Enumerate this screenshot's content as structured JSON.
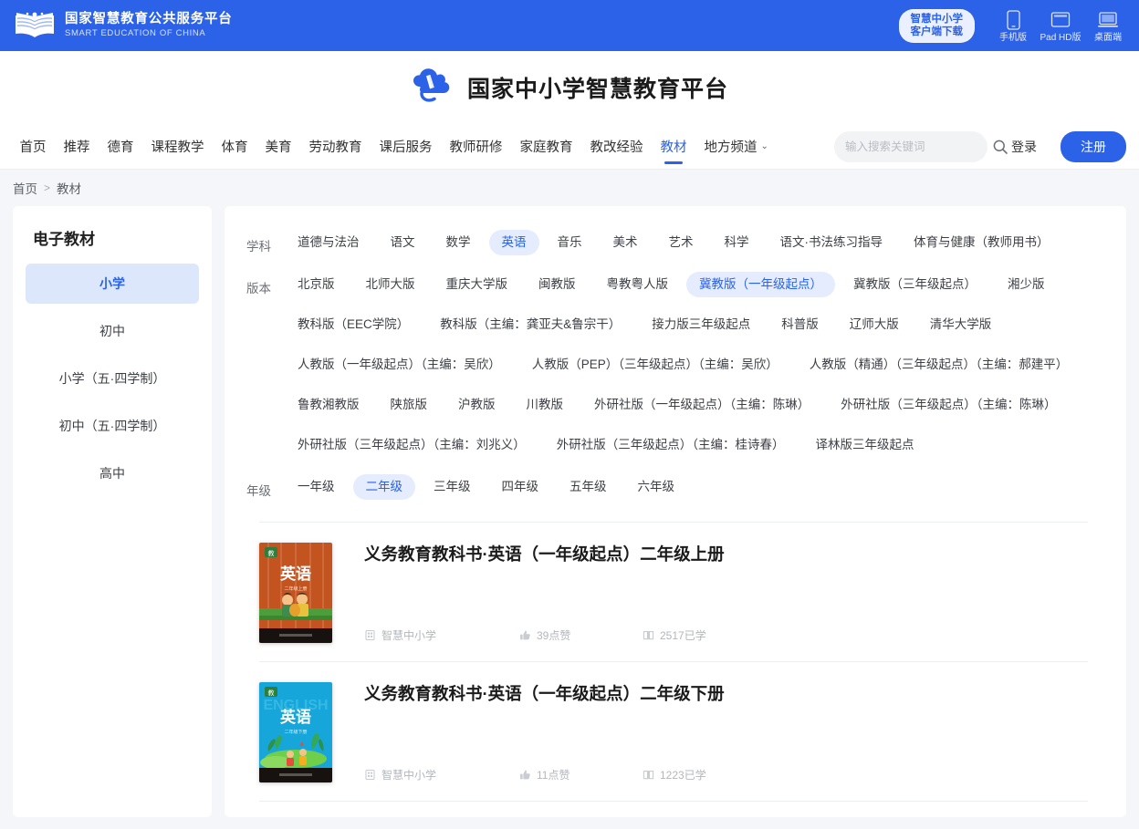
{
  "topbar": {
    "logo_cn": "国家智慧教育公共服务平台",
    "logo_en": "SMART EDUCATION OF CHINA",
    "client_download": {
      "line1": "智慧中小学",
      "line2": "客户端下载"
    },
    "download_items": [
      {
        "icon": "phone-icon",
        "label": "手机版"
      },
      {
        "icon": "tablet-icon",
        "label": "Pad HD版"
      },
      {
        "icon": "desktop-icon",
        "label": "桌面端"
      }
    ],
    "bg_color": "#2B62E8"
  },
  "brand": {
    "title": "国家中小学智慧教育平台",
    "icon": "cloud-pen-logo"
  },
  "nav": {
    "items": [
      {
        "label": "首页",
        "active": false
      },
      {
        "label": "推荐",
        "active": false
      },
      {
        "label": "德育",
        "active": false
      },
      {
        "label": "课程教学",
        "active": false
      },
      {
        "label": "体育",
        "active": false
      },
      {
        "label": "美育",
        "active": false
      },
      {
        "label": "劳动教育",
        "active": false
      },
      {
        "label": "课后服务",
        "active": false
      },
      {
        "label": "教师研修",
        "active": false
      },
      {
        "label": "家庭教育",
        "active": false
      },
      {
        "label": "教改经验",
        "active": false
      },
      {
        "label": "教材",
        "active": true
      },
      {
        "label": "地方频道",
        "active": false,
        "caret": true
      }
    ],
    "search": {
      "placeholder": "输入搜索关键词",
      "value": "",
      "icon": "search-icon"
    },
    "login_label": "登录",
    "register_label": "注册",
    "accent_color": "#2B62E8"
  },
  "breadcrumb": {
    "home": "首页",
    "separator": ">",
    "current": "教材"
  },
  "sidebar": {
    "title": "电子教材",
    "items": [
      {
        "label": "小学",
        "active": true
      },
      {
        "label": "初中",
        "active": false
      },
      {
        "label": "小学（五·四学制）",
        "active": false
      },
      {
        "label": "初中（五·四学制）",
        "active": false
      },
      {
        "label": "高中",
        "active": false
      }
    ]
  },
  "filters": [
    {
      "label": "学科",
      "rows": [
        [
          {
            "label": "道德与法治",
            "active": false
          },
          {
            "label": "语文",
            "active": false
          },
          {
            "label": "数学",
            "active": false
          },
          {
            "label": "英语",
            "active": true
          },
          {
            "label": "音乐",
            "active": false
          },
          {
            "label": "美术",
            "active": false
          },
          {
            "label": "艺术",
            "active": false
          },
          {
            "label": "科学",
            "active": false
          },
          {
            "label": "语文·书法练习指导",
            "active": false
          },
          {
            "label": "体育与健康（教师用书）",
            "active": false
          }
        ]
      ]
    },
    {
      "label": "版本",
      "rows": [
        [
          {
            "label": "北京版",
            "active": false
          },
          {
            "label": "北师大版",
            "active": false
          },
          {
            "label": "重庆大学版",
            "active": false
          },
          {
            "label": "闽教版",
            "active": false
          },
          {
            "label": "粤教粤人版",
            "active": false
          },
          {
            "label": "冀教版（一年级起点）",
            "active": true
          },
          {
            "label": "冀教版（三年级起点）",
            "active": false
          },
          {
            "label": "湘少版",
            "active": false
          }
        ],
        [
          {
            "label": "教科版（EEC学院）",
            "active": false
          },
          {
            "label": "教科版（主编：龚亚夫&鲁宗干）",
            "active": false
          },
          {
            "label": "接力版三年级起点",
            "active": false
          },
          {
            "label": "科普版",
            "active": false
          },
          {
            "label": "辽师大版",
            "active": false
          },
          {
            "label": "清华大学版",
            "active": false
          }
        ],
        [
          {
            "label": "人教版（一年级起点）（主编：吴欣）",
            "active": false
          },
          {
            "label": "人教版（PEP）（三年级起点）（主编：吴欣）",
            "active": false
          },
          {
            "label": "人教版（精通）（三年级起点）（主编：郝建平）",
            "active": false
          }
        ],
        [
          {
            "label": "鲁教湘教版",
            "active": false
          },
          {
            "label": "陕旅版",
            "active": false
          },
          {
            "label": "沪教版",
            "active": false
          },
          {
            "label": "川教版",
            "active": false
          },
          {
            "label": "外研社版（一年级起点）（主编：陈琳）",
            "active": false
          },
          {
            "label": "外研社版（三年级起点）（主编：陈琳）",
            "active": false
          }
        ],
        [
          {
            "label": "外研社版（三年级起点）（主编：刘兆义）",
            "active": false
          },
          {
            "label": "外研社版（三年级起点）（主编：桂诗春）",
            "active": false
          },
          {
            "label": "译林版三年级起点",
            "active": false
          }
        ]
      ]
    },
    {
      "label": "年级",
      "rows": [
        [
          {
            "label": "一年级",
            "active": false
          },
          {
            "label": "二年级",
            "active": true
          },
          {
            "label": "三年级",
            "active": false
          },
          {
            "label": "四年级",
            "active": false
          },
          {
            "label": "五年级",
            "active": false
          },
          {
            "label": "六年级",
            "active": false
          }
        ]
      ]
    }
  ],
  "books": [
    {
      "title": "义务教育教科书·英语（一年级起点）二年级上册",
      "cover": {
        "bg": "#C4541F",
        "subject": "英语",
        "badge_bg": "#2f7d3c"
      },
      "source": "智慧中小学",
      "likes": "39点赞",
      "learners": "2517已学"
    },
    {
      "title": "义务教育教科书·英语（一年级起点）二年级下册",
      "cover": {
        "bg": "#16A6D9",
        "subject": "英语",
        "badge_bg": "#2f7d3c"
      },
      "source": "智慧中小学",
      "likes": "11点赞",
      "learners": "1223已学"
    }
  ]
}
